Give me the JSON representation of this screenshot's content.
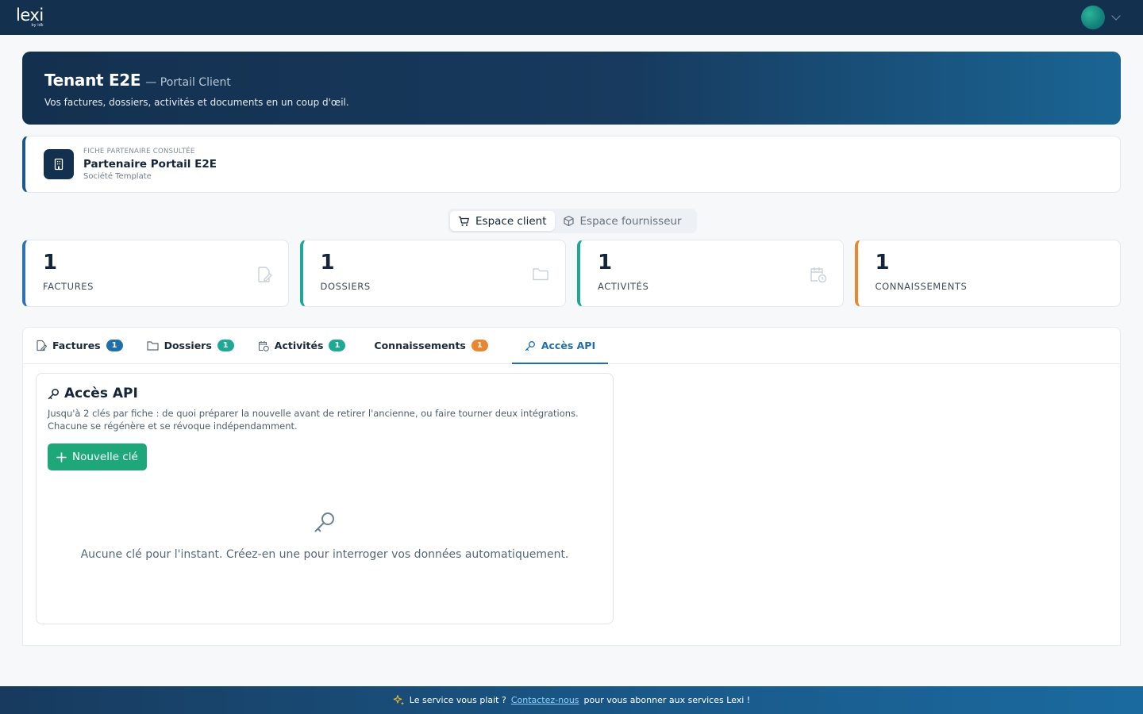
{
  "header": {
    "logo_text": "lexi",
    "logo_sub": "by idk"
  },
  "hero": {
    "title": "Tenant E2E",
    "subtitle": "— Portail Client",
    "description": "Vos factures, dossiers, activités et documents en un coup d'œil."
  },
  "partner": {
    "eyebrow": "FICHE PARTENAIRE CONSULTÉE",
    "name": "Partenaire Portail E2E",
    "company": "Société Template"
  },
  "spaces": {
    "client": "Espace client",
    "supplier": "Espace fournisseur"
  },
  "stats": [
    {
      "value": "1",
      "label": "FACTURES"
    },
    {
      "value": "1",
      "label": "DOSSIERS"
    },
    {
      "value": "1",
      "label": "ACTIVITÉS"
    },
    {
      "value": "1",
      "label": "CONNAISSEMENTS"
    }
  ],
  "tabs": [
    {
      "label": "Factures",
      "count": "1"
    },
    {
      "label": "Dossiers",
      "count": "1"
    },
    {
      "label": "Activités",
      "count": "1"
    },
    {
      "label": "Connaissements",
      "count": "1"
    },
    {
      "label": "Accès API"
    }
  ],
  "api": {
    "title": "Accès API",
    "description": "Jusqu'à 2 clés par fiche : de quoi préparer la nouvelle avant de retirer l'ancienne, ou faire tourner deux intégrations. Chacune se régénère et se révoque indépendamment.",
    "new_key_label": "Nouvelle clé",
    "empty_text": "Aucune clé pour l'instant. Créez-en une pour interroger vos données automatiquement."
  },
  "footer": {
    "prefix": "Le service vous plait ?",
    "link": "Contactez-nous",
    "suffix": "pour vous abonner aux services Lexi !"
  },
  "colors": {
    "navy": "#14304f",
    "accent_blue": "#1f6fa8",
    "accent_green": "#1ea896",
    "accent_orange": "#e8872f",
    "button_green": "#1ea87a"
  }
}
